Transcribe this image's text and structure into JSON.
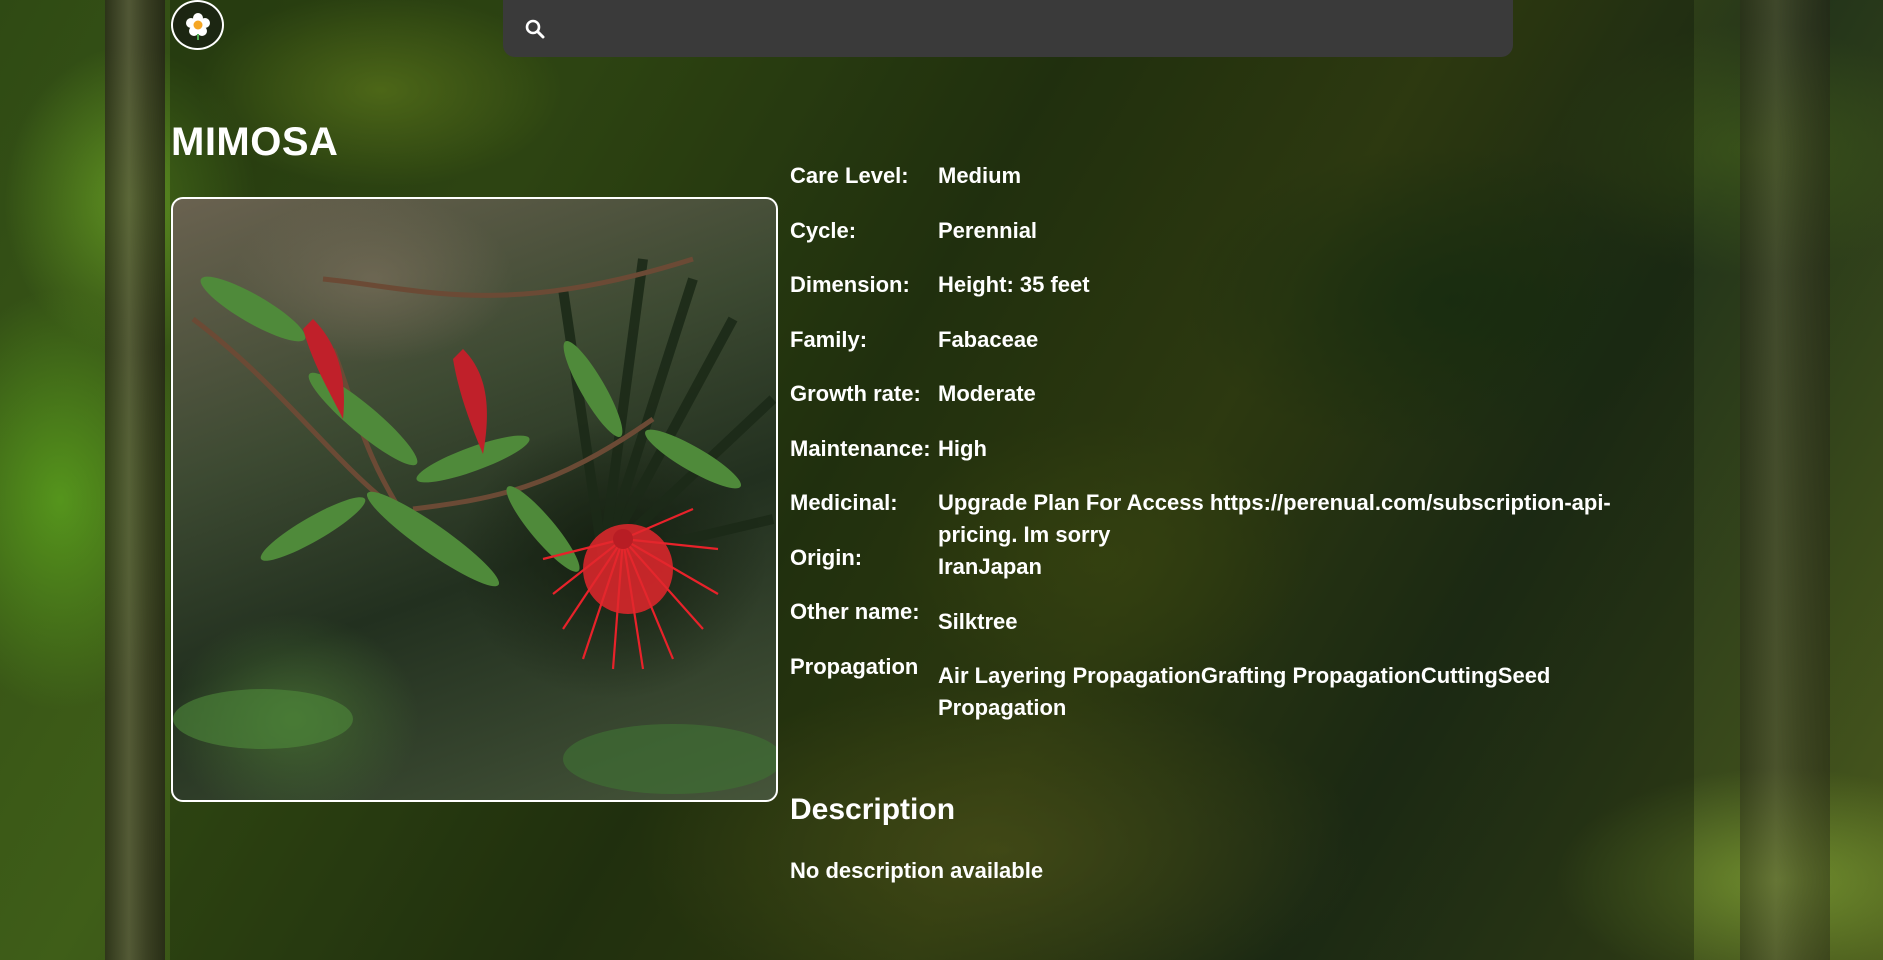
{
  "search": {
    "placeholder": "",
    "value": ""
  },
  "plant": {
    "name": "MIMOSA"
  },
  "details": [
    {
      "label": "Care Level:",
      "value": "Medium"
    },
    {
      "label": "Cycle:",
      "value": "Perennial"
    },
    {
      "label": "Dimension:",
      "value": "Height: 35 feet"
    },
    {
      "label": "Family:",
      "value": "Fabaceae"
    },
    {
      "label": "Growth rate:",
      "value": "Moderate"
    },
    {
      "label": "Maintenance:",
      "value": "High"
    },
    {
      "label": "Medicinal:",
      "value": "Upgrade Plan For Access https://perenual.com/subscription-api-pricing. Im sorry"
    },
    {
      "label": "Origin:",
      "value": "IranJapan"
    },
    {
      "label": "Other name:",
      "value": "Silktree"
    },
    {
      "label": "Propagation",
      "value": "Air Layering PropagationGrafting PropagationCuttingSeed Propagation"
    }
  ],
  "description": {
    "heading": "Description",
    "text": "No description available"
  },
  "icons": {
    "logo": "flower-logo-icon",
    "search": "search-icon"
  },
  "colors": {
    "search_bar_bg": "#3a3a3a",
    "text": "#ffffff",
    "image_border": "#ffffff"
  }
}
